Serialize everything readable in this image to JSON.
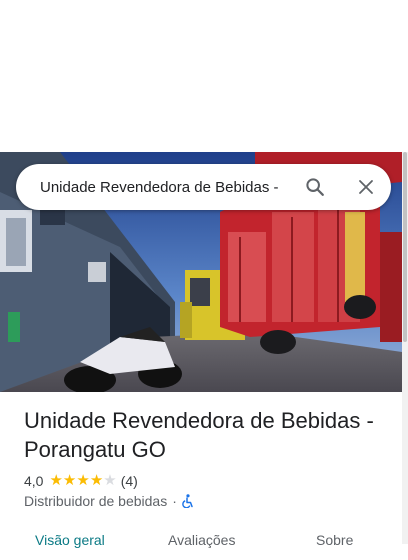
{
  "search": {
    "query": "Unidade Revendedora de Bebidas -",
    "search_icon": "search-icon",
    "close_icon": "close-icon"
  },
  "place": {
    "title_line1": "Unidade Revendedora de Bebidas -",
    "title_line2": "Porangatu GO",
    "rating": "4,0",
    "rating_value": 4,
    "rating_max": 5,
    "review_count": "(4)",
    "category": "Distribuidor de bebidas",
    "separator": "·",
    "accessibility_icon": "wheelchair-icon"
  },
  "tabs": [
    {
      "label": "Visão geral",
      "active": true
    },
    {
      "label": "Avaliações",
      "active": false
    },
    {
      "label": "Sobre",
      "active": false
    }
  ],
  "colors": {
    "star_on": "#fbbc04",
    "star_off": "#dadce0",
    "tab_active": "#0b7a85",
    "accessibility_blue": "#1a73e8"
  }
}
